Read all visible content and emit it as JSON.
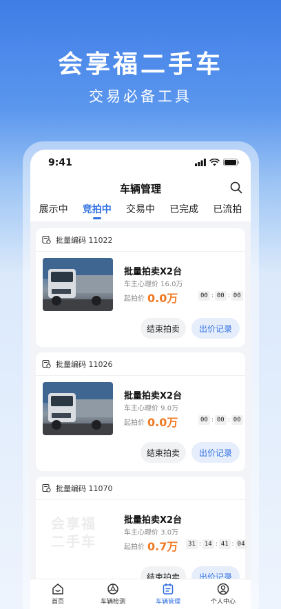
{
  "hero": {
    "title": "会享福二手车",
    "subtitle": "交易必备工具"
  },
  "status": {
    "time": "9:41"
  },
  "nav": {
    "title": "车辆管理"
  },
  "tabs": [
    {
      "label": "展示中"
    },
    {
      "label": "竞拍中",
      "active": true
    },
    {
      "label": "交易中"
    },
    {
      "label": "已完成"
    },
    {
      "label": "已流拍"
    }
  ],
  "cards": [
    {
      "batch": "批量编码 11022",
      "title": "批量拍卖X2台",
      "owner_price": "车主心理价 16.0万",
      "start_label": "起拍价",
      "start_value": "0.0万",
      "countdown": [
        "00",
        "00",
        "00"
      ],
      "end_label": "结束拍卖",
      "bid_label": "出价记录",
      "has_image": true
    },
    {
      "batch": "批量编码 11026",
      "title": "批量拍卖X2台",
      "owner_price": "车主心理价 9.0万",
      "start_label": "起拍价",
      "start_value": "0.0万",
      "countdown": [
        "00",
        "00",
        "00"
      ],
      "end_label": "结束拍卖",
      "bid_label": "出价记录",
      "has_image": true
    },
    {
      "batch": "批量编码 11070",
      "title": "批量拍卖X2台",
      "owner_price": "车主心理价 3.0万",
      "start_label": "起拍价",
      "start_value": "0.7万",
      "countdown": [
        "31",
        "14",
        "41",
        "04"
      ],
      "end_label": "结束拍卖",
      "bid_label": "出价记录",
      "has_image": false,
      "watermark_line1": "会享福",
      "watermark_line2": "二手车"
    }
  ],
  "tabbar": [
    {
      "label": "首页",
      "icon": "home-icon"
    },
    {
      "label": "车辆检测",
      "icon": "inspection-icon"
    },
    {
      "label": "车辆管理",
      "icon": "management-icon",
      "active": true
    },
    {
      "label": "个人中心",
      "icon": "profile-icon"
    }
  ],
  "colors": {
    "accent": "#2f6fe0",
    "price": "#f07a24"
  }
}
